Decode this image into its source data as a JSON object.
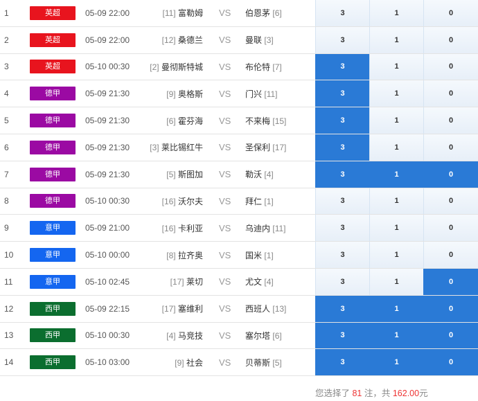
{
  "colors": {
    "epl": "#e8141e",
    "bundesliga": "#9b0aa3",
    "seriea": "#1466f0",
    "laliga": "#0b6e2f",
    "selected": "#2a7ad6",
    "highlight": "#e33333"
  },
  "matches": [
    {
      "no": "1",
      "league": "英超",
      "league_color": "#e8141e",
      "time": "05-09 22:00",
      "home_rank": "[11]",
      "home": "富勒姆",
      "vs": "VS",
      "away": "伯恩茅",
      "away_rank": "[6]",
      "odds": [
        "3",
        "1",
        "0"
      ],
      "selected": [
        false,
        false,
        false
      ]
    },
    {
      "no": "2",
      "league": "英超",
      "league_color": "#e8141e",
      "time": "05-09 22:00",
      "home_rank": "[12]",
      "home": "桑德兰",
      "vs": "VS",
      "away": "曼联",
      "away_rank": "[3]",
      "odds": [
        "3",
        "1",
        "0"
      ],
      "selected": [
        false,
        false,
        false
      ]
    },
    {
      "no": "3",
      "league": "英超",
      "league_color": "#e8141e",
      "time": "05-10 00:30",
      "home_rank": "[2]",
      "home": "曼彻斯特城",
      "vs": "VS",
      "away": "布伦特",
      "away_rank": "[7]",
      "odds": [
        "3",
        "1",
        "0"
      ],
      "selected": [
        true,
        false,
        false
      ]
    },
    {
      "no": "4",
      "league": "德甲",
      "league_color": "#9b0aa3",
      "time": "05-09 21:30",
      "home_rank": "[9]",
      "home": "奥格斯",
      "vs": "VS",
      "away": "门兴",
      "away_rank": "[11]",
      "odds": [
        "3",
        "1",
        "0"
      ],
      "selected": [
        true,
        false,
        false
      ]
    },
    {
      "no": "5",
      "league": "德甲",
      "league_color": "#9b0aa3",
      "time": "05-09 21:30",
      "home_rank": "[6]",
      "home": "霍芬海",
      "vs": "VS",
      "away": "不来梅",
      "away_rank": "[15]",
      "odds": [
        "3",
        "1",
        "0"
      ],
      "selected": [
        true,
        false,
        false
      ]
    },
    {
      "no": "6",
      "league": "德甲",
      "league_color": "#9b0aa3",
      "time": "05-09 21:30",
      "home_rank": "[3]",
      "home": "莱比锡红牛",
      "vs": "VS",
      "away": "圣保利",
      "away_rank": "[17]",
      "odds": [
        "3",
        "1",
        "0"
      ],
      "selected": [
        true,
        false,
        false
      ]
    },
    {
      "no": "7",
      "league": "德甲",
      "league_color": "#9b0aa3",
      "time": "05-09 21:30",
      "home_rank": "[5]",
      "home": "斯图加",
      "vs": "VS",
      "away": "勒沃",
      "away_rank": "[4]",
      "odds": [
        "3",
        "1",
        "0"
      ],
      "selected": [
        true,
        true,
        true
      ]
    },
    {
      "no": "8",
      "league": "德甲",
      "league_color": "#9b0aa3",
      "time": "05-10 00:30",
      "home_rank": "[16]",
      "home": "沃尔夫",
      "vs": "VS",
      "away": "拜仁",
      "away_rank": "[1]",
      "odds": [
        "3",
        "1",
        "0"
      ],
      "selected": [
        false,
        false,
        false
      ]
    },
    {
      "no": "9",
      "league": "意甲",
      "league_color": "#1466f0",
      "time": "05-09 21:00",
      "home_rank": "[16]",
      "home": "卡利亚",
      "vs": "VS",
      "away": "乌迪内",
      "away_rank": "[11]",
      "odds": [
        "3",
        "1",
        "0"
      ],
      "selected": [
        false,
        false,
        false
      ]
    },
    {
      "no": "10",
      "league": "意甲",
      "league_color": "#1466f0",
      "time": "05-10 00:00",
      "home_rank": "[8]",
      "home": "拉齐奥",
      "vs": "VS",
      "away": "国米",
      "away_rank": "[1]",
      "odds": [
        "3",
        "1",
        "0"
      ],
      "selected": [
        false,
        false,
        false
      ]
    },
    {
      "no": "11",
      "league": "意甲",
      "league_color": "#1466f0",
      "time": "05-10 02:45",
      "home_rank": "[17]",
      "home": "莱切",
      "vs": "VS",
      "away": "尤文",
      "away_rank": "[4]",
      "odds": [
        "3",
        "1",
        "0"
      ],
      "selected": [
        false,
        false,
        true
      ]
    },
    {
      "no": "12",
      "league": "西甲",
      "league_color": "#0b6e2f",
      "time": "05-09 22:15",
      "home_rank": "[17]",
      "home": "塞维利",
      "vs": "VS",
      "away": "西班人",
      "away_rank": "[13]",
      "odds": [
        "3",
        "1",
        "0"
      ],
      "selected": [
        true,
        true,
        true
      ]
    },
    {
      "no": "13",
      "league": "西甲",
      "league_color": "#0b6e2f",
      "time": "05-10 00:30",
      "home_rank": "[4]",
      "home": "马竞技",
      "vs": "VS",
      "away": "塞尔塔",
      "away_rank": "[6]",
      "odds": [
        "3",
        "1",
        "0"
      ],
      "selected": [
        true,
        true,
        true
      ]
    },
    {
      "no": "14",
      "league": "西甲",
      "league_color": "#0b6e2f",
      "time": "05-10 03:00",
      "home_rank": "[9]",
      "home": "社会",
      "vs": "VS",
      "away": "贝蒂斯",
      "away_rank": "[5]",
      "odds": [
        "3",
        "1",
        "0"
      ],
      "selected": [
        true,
        true,
        true
      ]
    }
  ],
  "summary": {
    "prefix": "您选择了 ",
    "count": "81",
    "mid": " 注，共 ",
    "amount": "162.00",
    "suffix": "元"
  }
}
